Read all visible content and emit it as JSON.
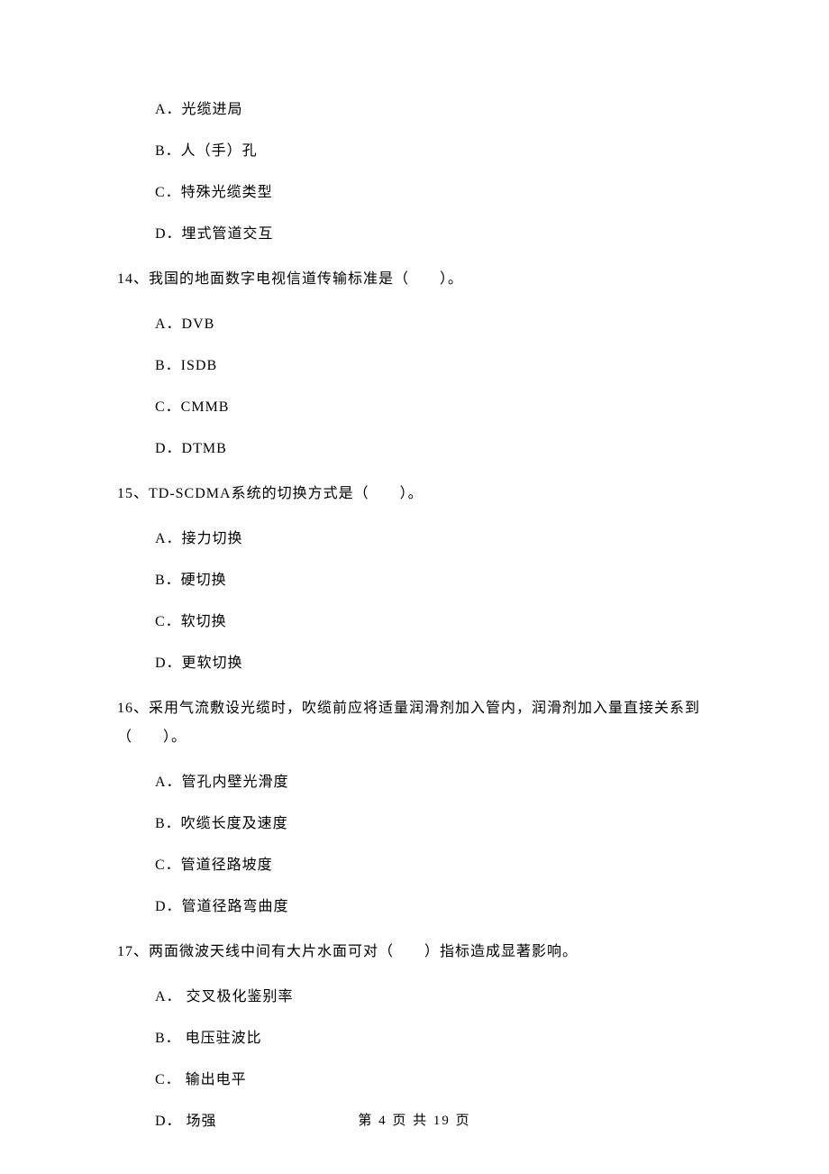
{
  "q13_options": {
    "a": "A．光缆进局",
    "b": "B．人（手）孔",
    "c": "C．特殊光缆类型",
    "d": "D．埋式管道交互"
  },
  "q14": {
    "text": "14、我国的地面数字电视信道传输标准是（　　）。",
    "a": "A．DVB",
    "b": "B．ISDB",
    "c": "C．CMMB",
    "d": "D．DTMB"
  },
  "q15": {
    "text": "15、TD-SCDMA系统的切换方式是（　　）。",
    "a": "A．接力切换",
    "b": "B．硬切换",
    "c": "C．软切换",
    "d": "D．更软切换"
  },
  "q16": {
    "text": "16、采用气流敷设光缆时，吹缆前应将适量润滑剂加入管内，润滑剂加入量直接关系到（　　）。",
    "a": "A．管孔内壁光滑度",
    "b": "B．吹缆长度及速度",
    "c": "C．管道径路坡度",
    "d": "D．管道径路弯曲度"
  },
  "q17": {
    "text": "17、两面微波天线中间有大片水面可对（　　）指标造成显著影响。",
    "a": "A． 交叉极化鉴别率",
    "b": "B． 电压驻波比",
    "c": "C． 输出电平",
    "d": "D． 场强"
  },
  "footer": "第 4 页 共 19 页"
}
